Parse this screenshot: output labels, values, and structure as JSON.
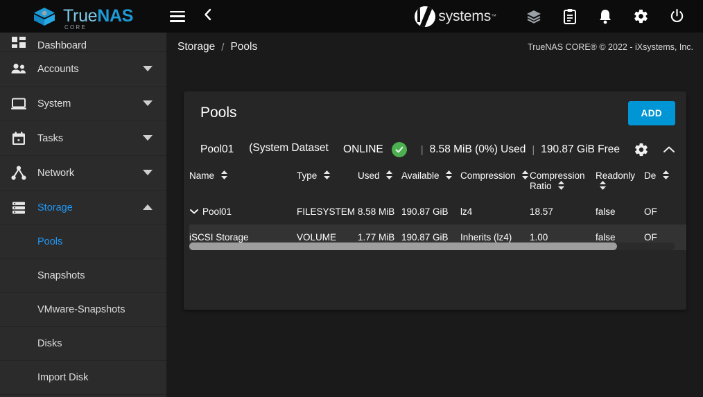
{
  "topbar": {
    "brand_true": "True",
    "brand_nas": "NAS",
    "brand_sub": "CORE",
    "menu_icon": "hamburger-menu-icon",
    "back_icon": "chevron-left-icon",
    "vendor_name": "systems",
    "vendor_tm": "™",
    "icons": [
      {
        "name": "layers-icon",
        "label": "Storage Layers"
      },
      {
        "name": "clipboard-icon",
        "label": "Tasks"
      },
      {
        "name": "bell-icon",
        "label": "Alerts"
      },
      {
        "name": "gear-icon",
        "label": "Settings"
      },
      {
        "name": "power-icon",
        "label": "Power"
      }
    ]
  },
  "sidebar": {
    "items": [
      {
        "label": "Dashboard",
        "icon": "dashboard-icon",
        "expandable": false,
        "active": false
      },
      {
        "label": "Accounts",
        "icon": "accounts-icon",
        "expandable": true,
        "active": false
      },
      {
        "label": "System",
        "icon": "system-icon",
        "expandable": true,
        "active": false
      },
      {
        "label": "Tasks",
        "icon": "tasks-icon",
        "expandable": true,
        "active": false
      },
      {
        "label": "Network",
        "icon": "network-icon",
        "expandable": true,
        "active": false
      },
      {
        "label": "Storage",
        "icon": "storage-icon",
        "expandable": true,
        "active": true,
        "expanded": true
      }
    ],
    "storage_children": [
      {
        "label": "Pools",
        "active": true
      },
      {
        "label": "Snapshots",
        "active": false
      },
      {
        "label": "VMware-Snapshots",
        "active": false
      },
      {
        "label": "Disks",
        "active": false
      },
      {
        "label": "Import Disk",
        "active": false
      }
    ]
  },
  "breadcrumb": {
    "parent": "Storage",
    "separator": "/",
    "current": "Pools",
    "copyright": "TrueNAS CORE® © 2022 - iXsystems, Inc."
  },
  "card": {
    "title": "Pools",
    "add_label": "ADD"
  },
  "pool": {
    "name": "Pool01",
    "system_dataset_note": "(System Dataset Pool)",
    "status": "ONLINE",
    "status_icon": "check-circle-icon",
    "used": "8.58 MiB (0%) Used",
    "free": "190.87 GiB Free",
    "separator": "|",
    "settings_icon": "gear-icon",
    "collapse_icon": "chevron-up-icon"
  },
  "table": {
    "columns": [
      {
        "label": "Name",
        "sortable": true
      },
      {
        "label": "Type",
        "sortable": true
      },
      {
        "label": "Used",
        "sortable": true
      },
      {
        "label": "Available",
        "sortable": true
      },
      {
        "label": "Compression",
        "sortable": true
      },
      {
        "label": "Compression Ratio",
        "sortable": true
      },
      {
        "label": "Readonly",
        "sortable": true
      },
      {
        "label": "De",
        "sortable": true
      }
    ],
    "rows": [
      {
        "name": "Pool01",
        "expandable": true,
        "indent": false,
        "type": "FILESYSTEM",
        "used": "8.58 MiB",
        "available": "190.87 GiB",
        "compression": "lz4",
        "compression_ratio": "18.57",
        "readonly": "false",
        "dedup": "OF",
        "highlighted": false
      },
      {
        "name": "iSCSI Storage",
        "expandable": false,
        "indent": true,
        "type": "VOLUME",
        "used": "1.77 MiB",
        "available": "190.87 GiB",
        "compression": "Inherits (lz4)",
        "compression_ratio": "1.00",
        "readonly": "false",
        "dedup": "OF",
        "highlighted": true
      }
    ]
  },
  "colors": {
    "accent": "#0095d5",
    "brand_blue": "#1e9ad6",
    "status_green": "#4caf50",
    "page_bg": "#1a1a1a",
    "card_bg": "#262626",
    "sidebar_bg": "#2b2b2b",
    "topbar_bg": "#0c0c0c"
  }
}
